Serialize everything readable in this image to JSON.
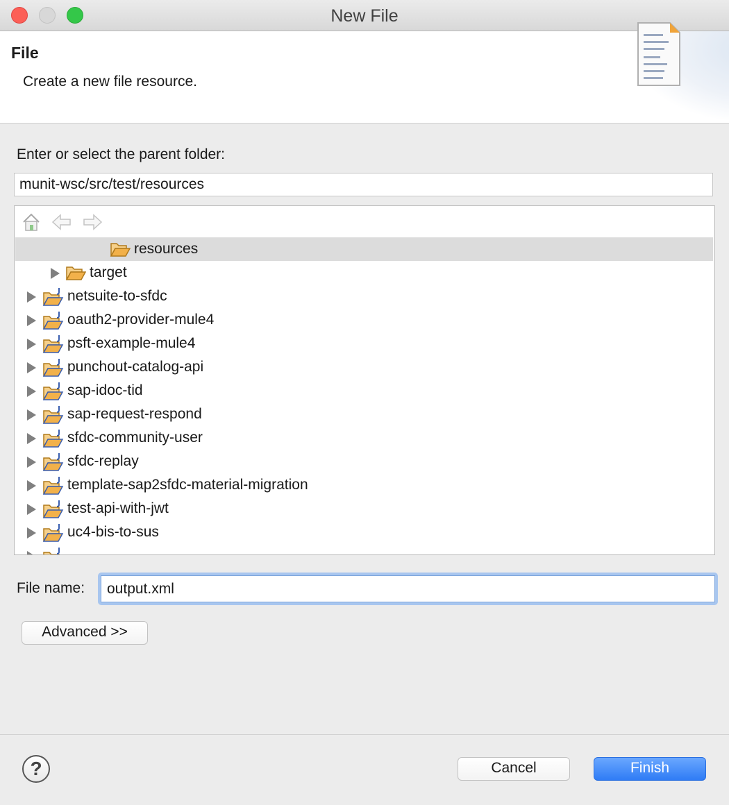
{
  "window": {
    "title": "New File"
  },
  "banner": {
    "title": "File",
    "description": "Create a new file resource."
  },
  "parent_folder": {
    "label": "Enter or select the parent folder:",
    "value": "munit-wsc/src/test/resources"
  },
  "tree": {
    "toolbar": [
      "home-icon",
      "back-arrow-icon",
      "forward-arrow-icon"
    ],
    "items": [
      {
        "label": "resources",
        "selected": true,
        "expandable": false,
        "type": "folder"
      },
      {
        "label": "target",
        "selected": false,
        "expandable": true,
        "type": "folder"
      },
      {
        "label": "netsuite-to-sfdc",
        "selected": false,
        "expandable": true,
        "type": "project"
      },
      {
        "label": "oauth2-provider-mule4",
        "selected": false,
        "expandable": true,
        "type": "project"
      },
      {
        "label": "psft-example-mule4",
        "selected": false,
        "expandable": true,
        "type": "project"
      },
      {
        "label": "punchout-catalog-api",
        "selected": false,
        "expandable": true,
        "type": "project"
      },
      {
        "label": "sap-idoc-tid",
        "selected": false,
        "expandable": true,
        "type": "project"
      },
      {
        "label": "sap-request-respond",
        "selected": false,
        "expandable": true,
        "type": "project"
      },
      {
        "label": "sfdc-community-user",
        "selected": false,
        "expandable": true,
        "type": "project"
      },
      {
        "label": "sfdc-replay",
        "selected": false,
        "expandable": true,
        "type": "project"
      },
      {
        "label": "template-sap2sfdc-material-migration",
        "selected": false,
        "expandable": true,
        "type": "project"
      },
      {
        "label": "test-api-with-jwt",
        "selected": false,
        "expandable": true,
        "type": "project"
      },
      {
        "label": "uc4-bis-to-sus",
        "selected": false,
        "expandable": true,
        "type": "project"
      }
    ]
  },
  "file_name": {
    "label": "File name:",
    "value": "output.xml"
  },
  "buttons": {
    "advanced": "Advanced >>",
    "help": "?",
    "cancel": "Cancel",
    "finish": "Finish"
  },
  "colors": {
    "accent": "#2f7cf5",
    "selection": "#dcdcdc",
    "folder": "#f2b14a"
  }
}
